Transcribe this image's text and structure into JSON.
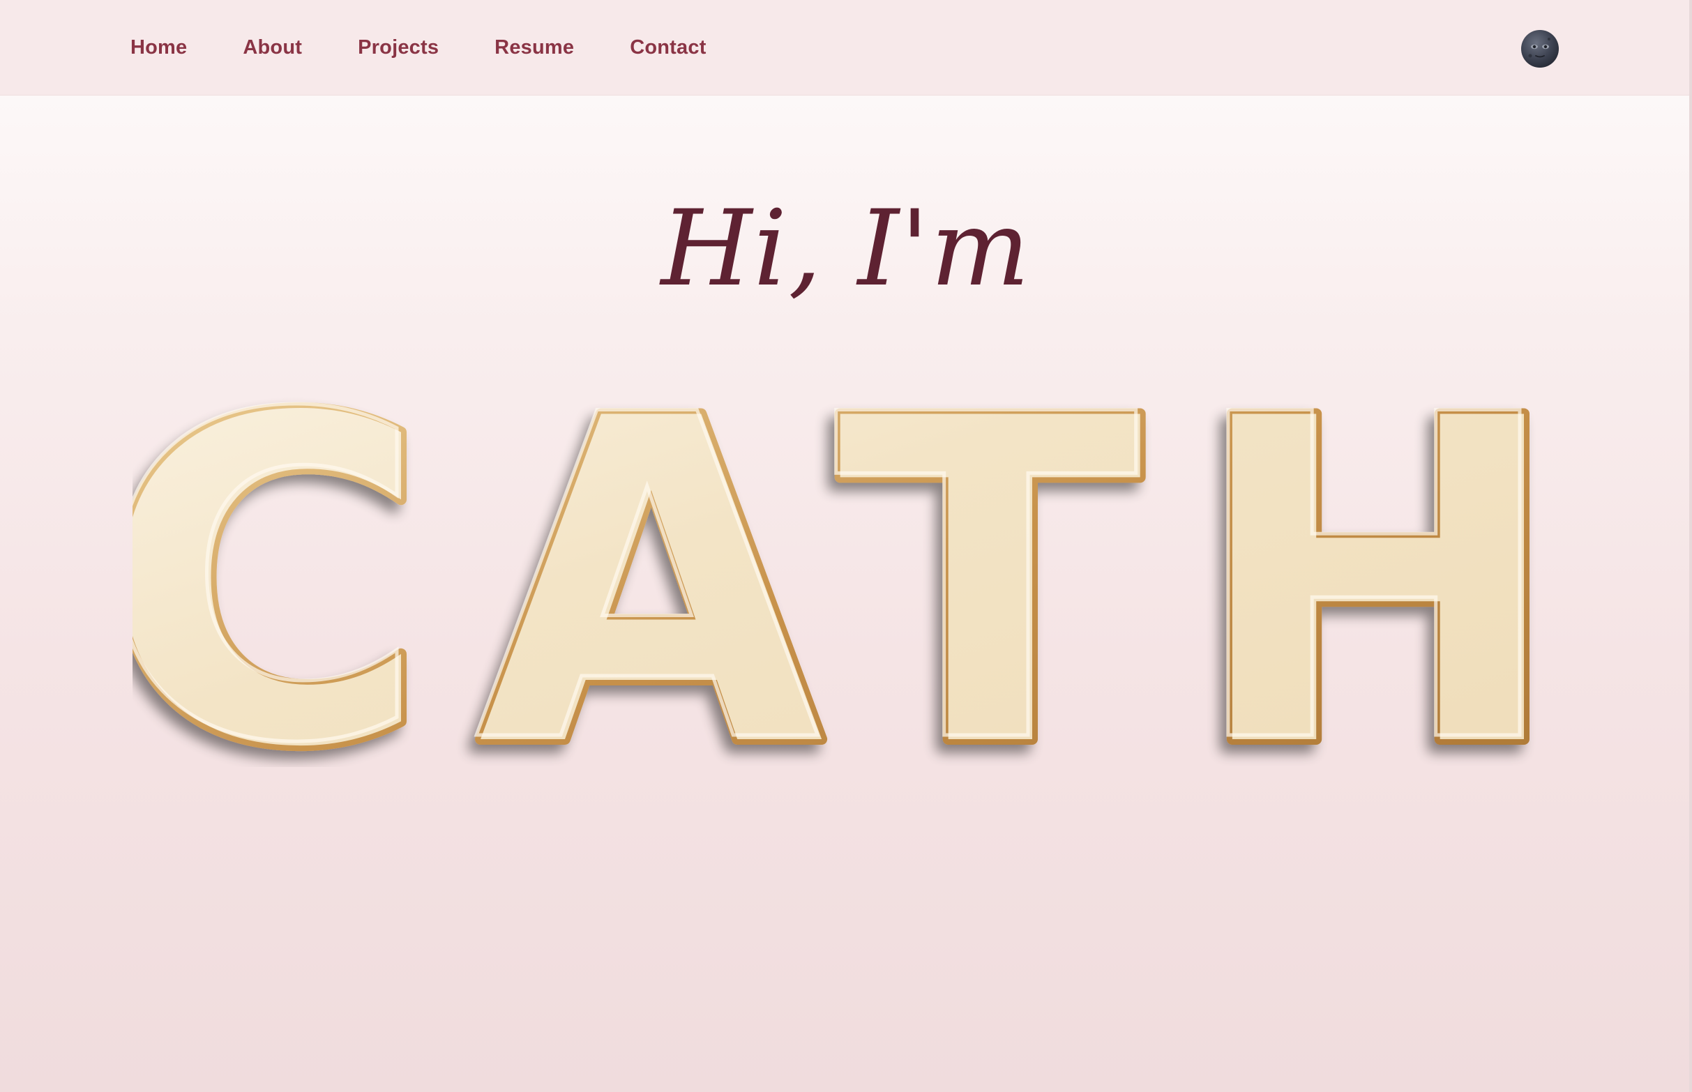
{
  "nav": {
    "links": [
      "Home",
      "About",
      "Projects",
      "Resume",
      "Contact"
    ],
    "theme_toggle_icon": "new-moon-face-icon"
  },
  "hero": {
    "greeting": "Hi, I'm",
    "name": "CATH"
  },
  "colors": {
    "nav_background": "#f7e9ea",
    "nav_link": "#8a3445",
    "greeting": "#5e2232",
    "balloon_gold_light": "#f6ead2",
    "balloon_gold_dark": "#c9974f"
  }
}
